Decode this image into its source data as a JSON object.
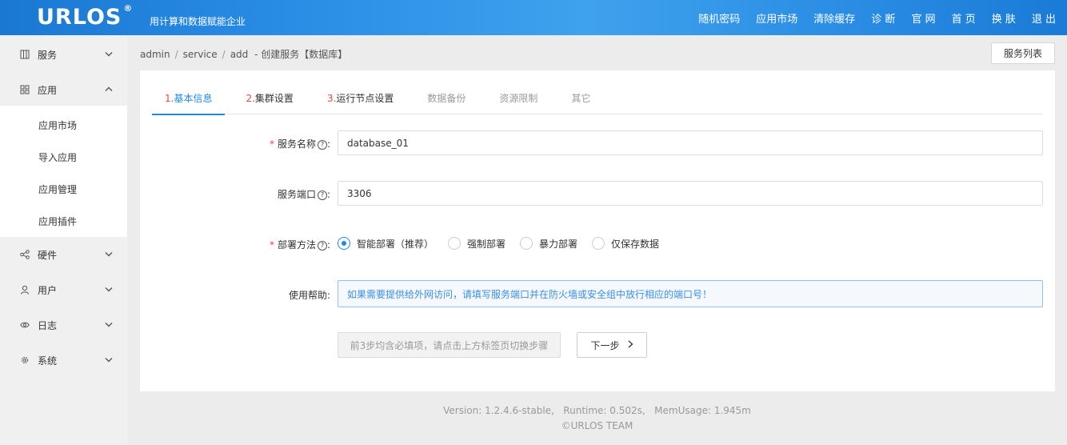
{
  "header": {
    "logo": "URLOS",
    "logo_mark": "®",
    "tagline": "用计算和数据赋能企业",
    "nav": [
      "随机密码",
      "应用市场",
      "清除缓存",
      "诊 断",
      "官 网",
      "首 页",
      "换 肤",
      "退 出"
    ]
  },
  "sidebar": {
    "items": [
      {
        "label": "服务",
        "icon": "grid-icon",
        "chevron": "down"
      },
      {
        "label": "应用",
        "icon": "apps-icon",
        "chevron": "up"
      },
      {
        "label": "硬件",
        "icon": "share-icon",
        "chevron": "down"
      },
      {
        "label": "用户",
        "icon": "user-icon",
        "chevron": "down"
      },
      {
        "label": "日志",
        "icon": "eye-icon",
        "chevron": "down"
      },
      {
        "label": "系统",
        "icon": "settings-icon",
        "chevron": "down"
      }
    ],
    "sub_items": [
      "应用市场",
      "导入应用",
      "应用管理",
      "应用插件"
    ]
  },
  "breadcrumb": {
    "parts": [
      "admin",
      "service",
      "add"
    ],
    "suffix": "- 创建服务【数据库】"
  },
  "list_button": "服务列表",
  "tabs": [
    {
      "num": "1.",
      "label": "基本信息",
      "state": "active"
    },
    {
      "num": "2.",
      "label": "集群设置",
      "state": "done"
    },
    {
      "num": "3.",
      "label": "运行节点设置",
      "state": "done"
    },
    {
      "num": "",
      "label": "数据备份",
      "state": "disabled"
    },
    {
      "num": "",
      "label": "资源限制",
      "state": "disabled"
    },
    {
      "num": "",
      "label": "其它",
      "state": "disabled"
    }
  ],
  "form": {
    "service_name": {
      "label": "服务名称",
      "value": "database_01"
    },
    "service_port": {
      "label": "服务端口",
      "value": "3306"
    },
    "deploy": {
      "label": "部署方法",
      "options": [
        "智能部署（推荐）",
        "强制部署",
        "暴力部署",
        "仅保存数据"
      ],
      "selected": 0
    },
    "help": {
      "label": "使用帮助:",
      "text": "如果需要提供给外网访问，请填写服务端口并在防火墙或安全组中放行相应的端口号！"
    }
  },
  "buttons": {
    "notice": "前3步均含必填项，请点击上方标签页切换步骤",
    "next": "下一步"
  },
  "footer": {
    "version_line": "Version: 1.2.4.6-stable,   Runtime: 0.502s,   MemUsage: 1.945m",
    "team": "©URLOS TEAM"
  },
  "colors": {
    "accent": "#1e88e5",
    "required": "#e0493a",
    "header": "#2b8fe6"
  }
}
